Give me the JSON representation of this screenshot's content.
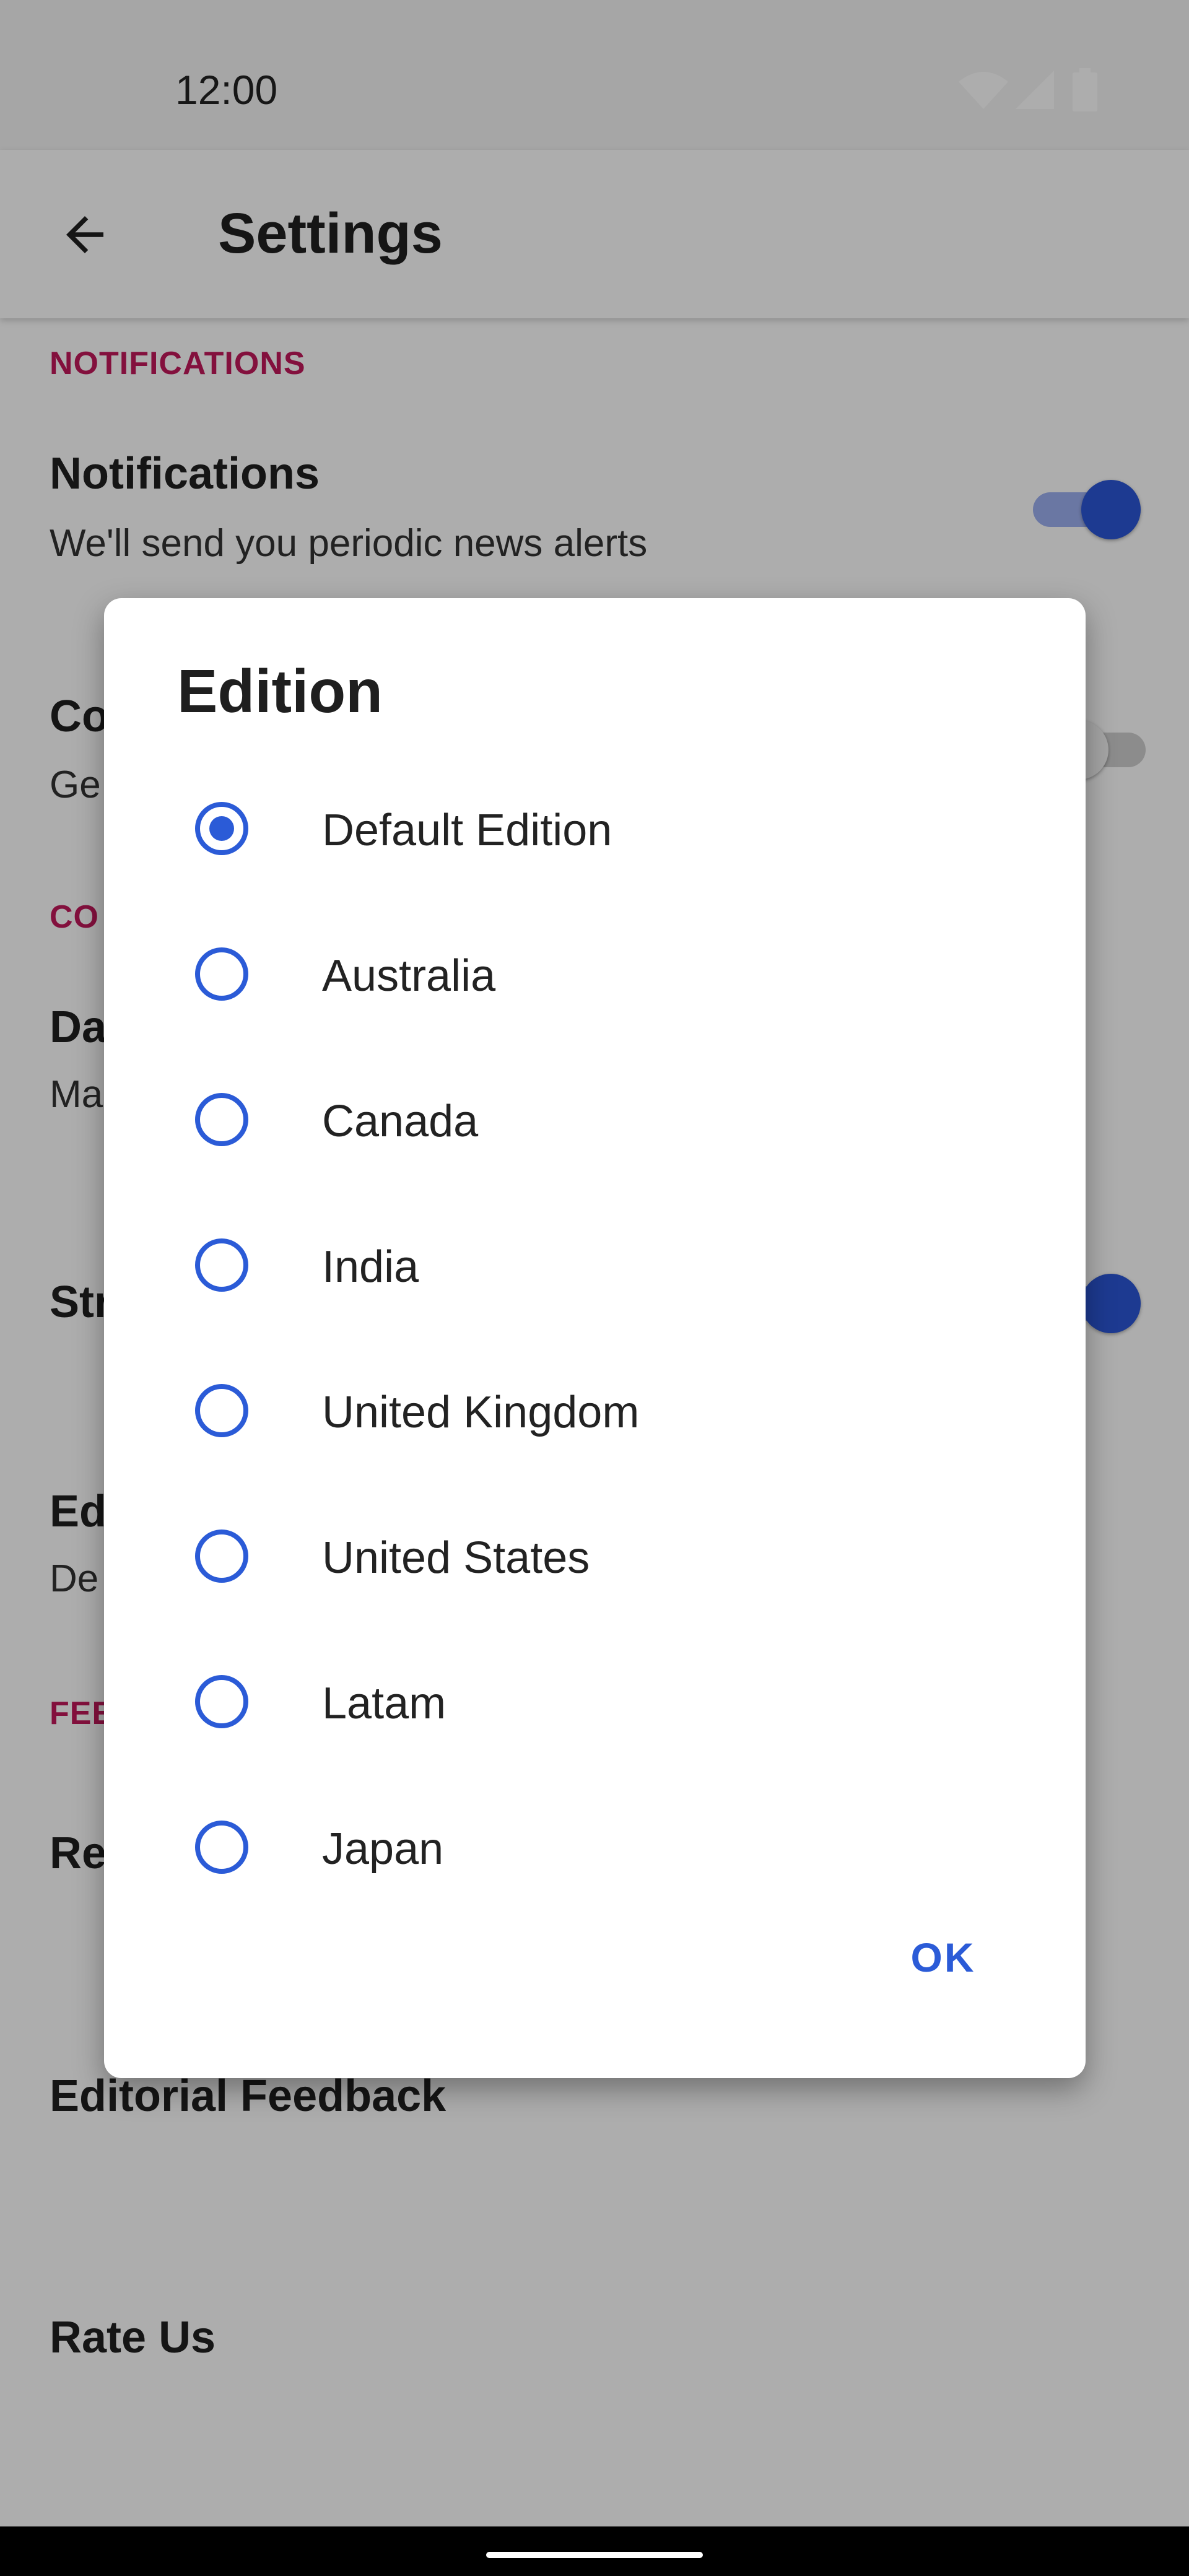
{
  "status_bar": {
    "time": "12:00",
    "icons": [
      "wifi-icon",
      "signal-icon",
      "battery-icon"
    ]
  },
  "app_bar": {
    "title": "Settings",
    "back_icon": "arrow-back-icon"
  },
  "settings": {
    "notifications_header": "NOTIFICATIONS",
    "notifications_title": "Notifications",
    "notifications_subtitle": "We'll send you periodic news alerts",
    "notifications_enabled": true,
    "item2_title": "Co",
    "item2_subtitle": "Ge",
    "item2_enabled": false,
    "section2_header": "CO",
    "item3_title": "Da",
    "item3_subtitle": "Ma",
    "item4_title": "Str",
    "item4_enabled": true,
    "item5_title": "Ed",
    "item5_subtitle": "De",
    "section3_header": "FEE",
    "item6_title": "Re",
    "editorial_feedback": "Editorial Feedback",
    "rate_us": "Rate Us"
  },
  "dialog": {
    "title": "Edition",
    "options": [
      {
        "label": "Default Edition",
        "selected": true
      },
      {
        "label": "Australia",
        "selected": false
      },
      {
        "label": "Canada",
        "selected": false
      },
      {
        "label": "India",
        "selected": false
      },
      {
        "label": "United Kingdom",
        "selected": false
      },
      {
        "label": "United States",
        "selected": false
      },
      {
        "label": "Latam",
        "selected": false
      },
      {
        "label": "Japan",
        "selected": false
      }
    ],
    "ok_label": "OK"
  },
  "colors": {
    "accent": "#2b5bd7",
    "section_header": "#c2185b",
    "toggle_on": "#2b56d6",
    "scrim": "rgba(0,0,0,0.32)"
  }
}
